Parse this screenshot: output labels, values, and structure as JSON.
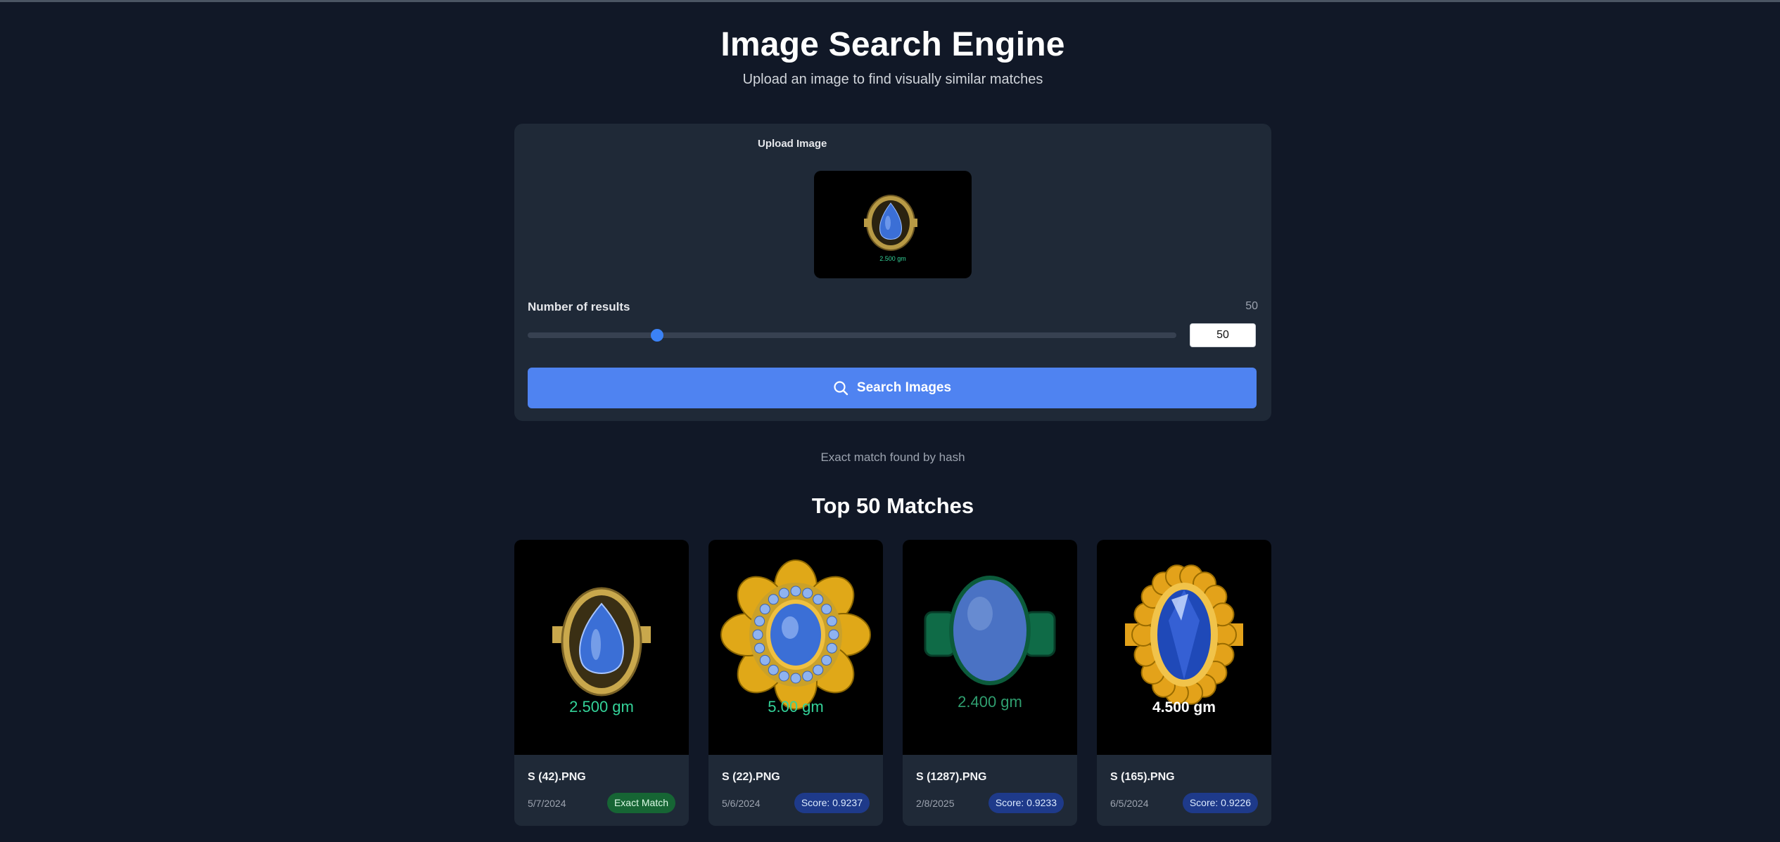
{
  "header": {
    "title": "Image Search Engine",
    "subtitle": "Upload an image to find visually similar matches"
  },
  "upload": {
    "label": "Upload Image",
    "preview_caption": "2.500 gm"
  },
  "results_control": {
    "label": "Number of results",
    "value_display": "50",
    "input_value": "50",
    "slider_fraction": 0.2
  },
  "search_button": {
    "label": "Search Images",
    "icon": "search-icon"
  },
  "status_message": "Exact match found by hash",
  "matches": {
    "title": "Top 50 Matches",
    "items": [
      {
        "name": "S (42).PNG",
        "date": "5/7/2024",
        "badge": "Exact Match",
        "badge_type": "exact",
        "weight_text": "2.500 gm",
        "weight_color": "#34d399",
        "gem_color": "#3b6fd6",
        "metal_color": "#c9a84c",
        "style": "pear"
      },
      {
        "name": "S (22).PNG",
        "date": "5/6/2024",
        "badge": "Score: 0.9237",
        "badge_type": "score",
        "weight_text": "5.00 gm",
        "weight_color": "#34d399",
        "gem_color": "#3b6fd6",
        "metal_color": "#e0a818",
        "style": "flower"
      },
      {
        "name": "S (1287).PNG",
        "date": "2/8/2025",
        "badge": "Score: 0.9233",
        "badge_type": "score",
        "weight_text": "2.400 gm",
        "weight_color": "#2f9e6f",
        "gem_color": "#4a72c4",
        "metal_color": "#0f6b47",
        "style": "oval"
      },
      {
        "name": "S (165).PNG",
        "date": "6/5/2024",
        "badge": "Score: 0.9226",
        "badge_type": "score",
        "weight_text": "4.500 gm",
        "weight_color": "#ffffff",
        "gem_color": "#1f49b8",
        "metal_color": "#e3a21a",
        "style": "faceted"
      }
    ]
  },
  "colors": {
    "background": "#111827",
    "panel": "#1f2937",
    "accent": "#4f83f1",
    "slider": "#3b82f6"
  }
}
